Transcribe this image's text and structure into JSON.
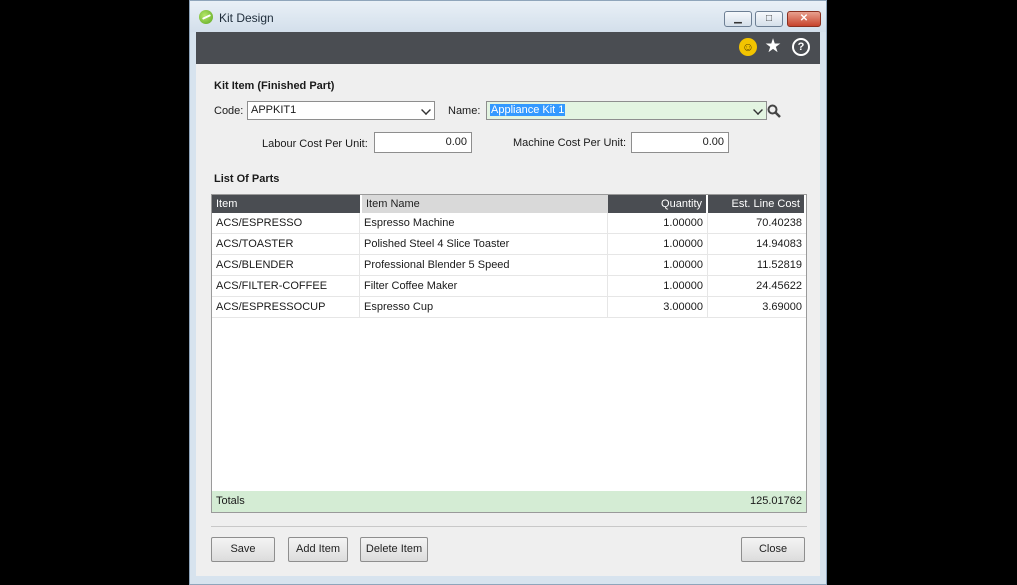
{
  "window": {
    "title": "Kit Design",
    "min_glyph": "▁",
    "max_glyph": "□",
    "close_glyph": "✕"
  },
  "toolbar": {
    "icons": [
      "smiley-icon",
      "star-icon",
      "help-icon"
    ],
    "star_glyph": "★",
    "help_glyph": "?",
    "smile_glyph": "☺"
  },
  "kit_item": {
    "section_title": "Kit Item (Finished Part)",
    "code_label": "Code:",
    "code_value": "APPKIT1",
    "name_label": "Name:",
    "name_value": "Appliance Kit 1",
    "labour_label": "Labour Cost Per Unit:",
    "labour_value": "0.00",
    "machine_label": "Machine Cost Per Unit:",
    "machine_value": "0.00"
  },
  "parts": {
    "section_title": "List Of Parts",
    "columns": [
      "Item",
      "Item Name",
      "Quantity",
      "Est. Line Cost"
    ],
    "rows": [
      {
        "item": "ACS/ESPRESSO",
        "name": "Espresso Machine",
        "qty": "1.00000",
        "cost": "70.40238"
      },
      {
        "item": "ACS/TOASTER",
        "name": "Polished Steel 4 Slice Toaster",
        "qty": "1.00000",
        "cost": "14.94083"
      },
      {
        "item": "ACS/BLENDER",
        "name": "Professional Blender 5 Speed",
        "qty": "1.00000",
        "cost": "11.52819"
      },
      {
        "item": "ACS/FILTER-COFFEE",
        "name": "Filter Coffee Maker",
        "qty": "1.00000",
        "cost": "24.45622"
      },
      {
        "item": "ACS/ESPRESSOCUP",
        "name": "Espresso Cup",
        "qty": "3.00000",
        "cost": "3.69000"
      }
    ],
    "totals_label": "Totals",
    "totals_value": "125.01762"
  },
  "buttons": {
    "save": "Save",
    "add_item": "Add Item",
    "delete_item": "Delete Item",
    "close": "Close"
  },
  "colors": {
    "toolbar_bg": "#4a4d52",
    "totals_bg": "#d4ecd4",
    "selection": "#3399ff"
  }
}
